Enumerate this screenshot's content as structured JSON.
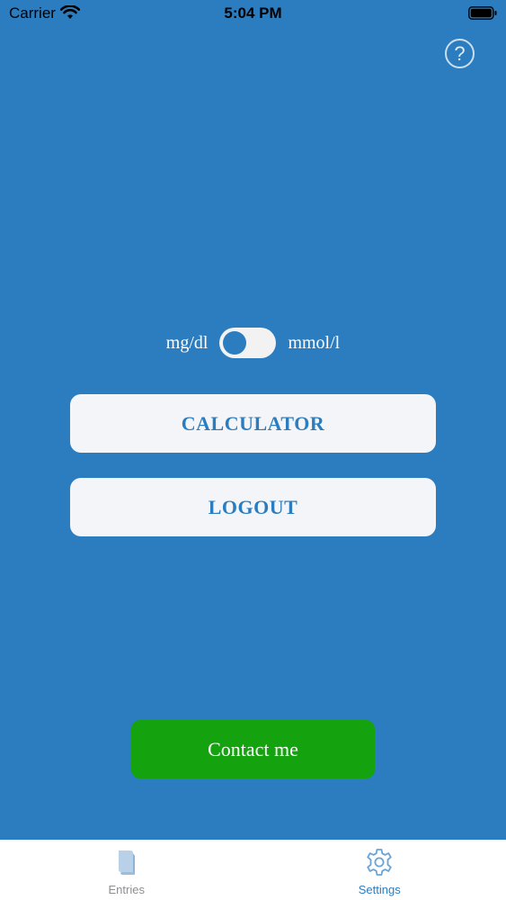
{
  "status_bar": {
    "carrier": "Carrier",
    "time": "5:04 PM"
  },
  "units": {
    "left_label": "mg/dl",
    "right_label": "mmol/l",
    "selected": "mg/dl"
  },
  "buttons": {
    "calculator": "CALCULATOR",
    "logout": "LOGOUT",
    "contact": "Contact me"
  },
  "tab_bar": {
    "items": [
      {
        "label": "Entries",
        "icon": "book-icon",
        "active": false
      },
      {
        "label": "Settings",
        "icon": "gear-icon",
        "active": true
      }
    ]
  },
  "colors": {
    "background": "#2b7dbf",
    "accent": "#2b7dbf",
    "contact": "#14a20e",
    "inactive_tab": "#8e8e93"
  }
}
